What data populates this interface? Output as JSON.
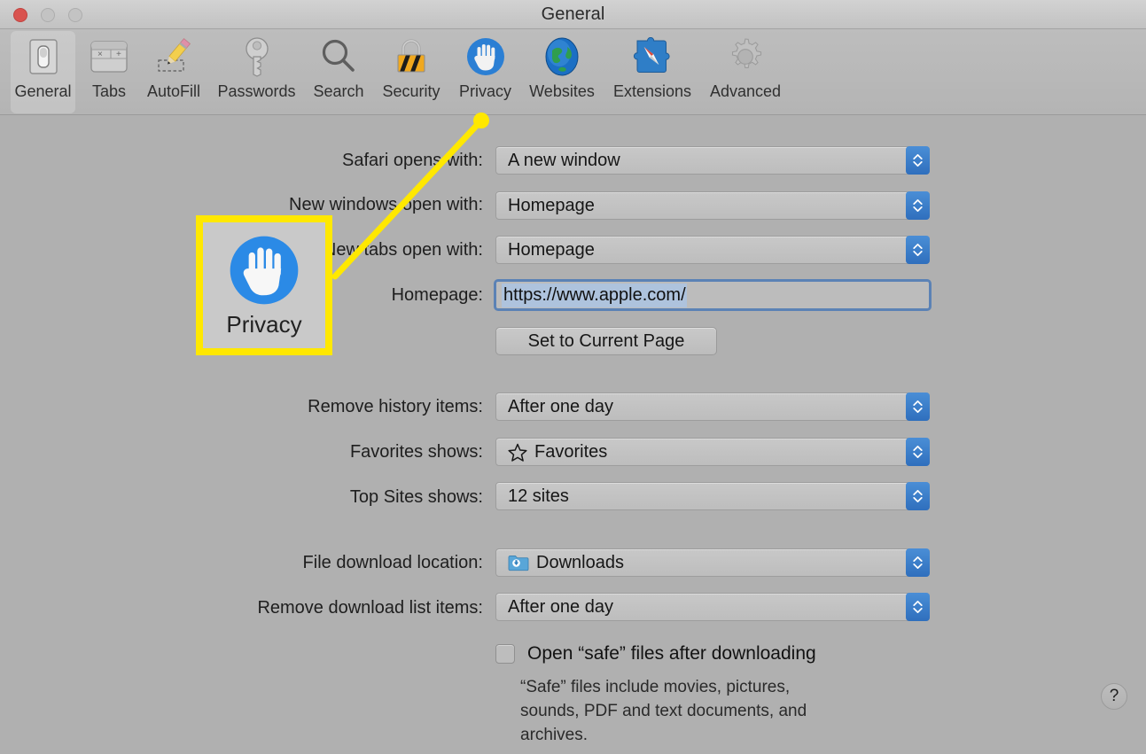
{
  "window": {
    "title": "General",
    "traffic_lights": [
      "close",
      "minimize",
      "maximize"
    ]
  },
  "toolbar": {
    "items": [
      {
        "label": "General",
        "icon": "general-switch-icon",
        "selected": true
      },
      {
        "label": "Tabs",
        "icon": "tabs-icon",
        "selected": false
      },
      {
        "label": "AutoFill",
        "icon": "autofill-pencil-icon",
        "selected": false
      },
      {
        "label": "Passwords",
        "icon": "key-icon",
        "selected": false
      },
      {
        "label": "Search",
        "icon": "search-magnifier-icon",
        "selected": false
      },
      {
        "label": "Security",
        "icon": "padlock-icon",
        "selected": false
      },
      {
        "label": "Privacy",
        "icon": "privacy-hand-icon",
        "selected": false
      },
      {
        "label": "Websites",
        "icon": "globe-icon",
        "selected": false
      },
      {
        "label": "Extensions",
        "icon": "extensions-puzzle-icon",
        "selected": false
      },
      {
        "label": "Advanced",
        "icon": "gear-icon",
        "selected": false
      }
    ]
  },
  "settings": {
    "safari_opens_with": {
      "label": "Safari opens with:",
      "value": "A new window"
    },
    "new_windows_open_with": {
      "label": "New windows open with:",
      "value": "Homepage"
    },
    "new_tabs_open_with": {
      "label": "New tabs open with:",
      "value": "Homepage"
    },
    "homepage": {
      "label": "Homepage:",
      "value": "https://www.apple.com/"
    },
    "set_current_page_button": {
      "label": "Set to Current Page"
    },
    "remove_history_items": {
      "label": "Remove history items:",
      "value": "After one day"
    },
    "favorites_shows": {
      "label": "Favorites shows:",
      "value": "Favorites",
      "icon": "star-icon"
    },
    "top_sites_shows": {
      "label": "Top Sites shows:",
      "value": "12 sites"
    },
    "file_download_location": {
      "label": "File download location:",
      "value": "Downloads",
      "icon": "downloads-folder-icon"
    },
    "remove_download_items": {
      "label": "Remove download list items:",
      "value": "After one day"
    },
    "open_safe_files": {
      "label": "Open “safe” files after downloading",
      "checked": false
    },
    "safe_files_description": "“Safe” files include movies, pictures,\nsounds, PDF and text documents, and\narchives."
  },
  "help_button": {
    "label": "?"
  },
  "callout": {
    "label": "Privacy",
    "icon": "privacy-hand-icon",
    "highlight_color": "#ffe800"
  },
  "colors": {
    "window_bg": "#b0b0b0",
    "toolbar_bg": "#b7b7b7",
    "accent_blue": "#2f6fbd",
    "privacy_blue": "#2b7fd4",
    "highlight_yellow": "#ffe800",
    "selection_blue": "#aec3dd",
    "close_red": "#d9534f"
  }
}
